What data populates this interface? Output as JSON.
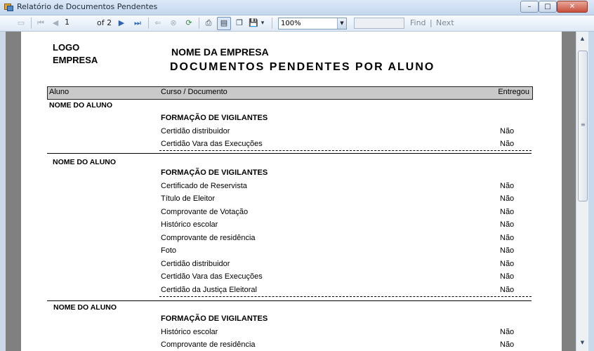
{
  "window": {
    "title": "Relatório de Documentos Pendentes",
    "buttons": {
      "minimize": "–",
      "maximize": "□",
      "close": "✕"
    }
  },
  "toolbar": {
    "page_current": "1",
    "page_total_label": "of 2",
    "zoom": "100%",
    "find_query": "",
    "find_label": "Find",
    "separator": "|",
    "next_label": "Next",
    "icons": {
      "first_page": "⏮",
      "previous_page": "◀",
      "next_page": "▶",
      "last_page": "⏭",
      "back": "⇐",
      "stop": "⊗",
      "refresh": "⟳",
      "print": "⎙",
      "print_layout": "▤",
      "page_setup": "❐",
      "export": "▾",
      "dropdown": "▼",
      "save": "💾"
    }
  },
  "report": {
    "logo_line1": "LOGO",
    "logo_line2": "EMPRESA",
    "company_name": "NOME DA EMPRESA",
    "title": "DOCUMENTOS PENDENTES POR ALUNO",
    "columns": {
      "student": "Aluno",
      "course_document": "Curso / Documento",
      "delivered": "Entregou"
    },
    "groups": [
      {
        "student": "NOME DO ALUNO",
        "course": "FORMAÇÃO DE VIGILANTES",
        "documents": [
          {
            "name": "Certidão distribuidor",
            "delivered": "Não"
          },
          {
            "name": "Certidão Vara das Execuções",
            "delivered": "Não"
          }
        ]
      },
      {
        "student": "NOME DO ALUNO",
        "course": "FORMAÇÃO DE VIGILANTES",
        "documents": [
          {
            "name": "Certificado de Reservista",
            "delivered": "Não"
          },
          {
            "name": "Título de Eleitor",
            "delivered": "Não"
          },
          {
            "name": "Comprovante de Votação",
            "delivered": "Não"
          },
          {
            "name": "Histórico escolar",
            "delivered": "Não"
          },
          {
            "name": "Comprovante de residência",
            "delivered": "Não"
          },
          {
            "name": "Foto",
            "delivered": "Não"
          },
          {
            "name": "Certidão distribuidor",
            "delivered": "Não"
          },
          {
            "name": "Certidão Vara das Execuções",
            "delivered": "Não"
          },
          {
            "name": "Certidão da Justiça Eleitoral",
            "delivered": "Não"
          }
        ]
      },
      {
        "student": "NOME DO ALUNO",
        "course": "FORMAÇÃO DE VIGILANTES",
        "documents": [
          {
            "name": "Histórico escolar",
            "delivered": "Não"
          },
          {
            "name": "Comprovante de residência",
            "delivered": "Não"
          }
        ]
      }
    ]
  },
  "scrollbar": {
    "up": "▲",
    "down": "▼",
    "grip": "≡"
  }
}
